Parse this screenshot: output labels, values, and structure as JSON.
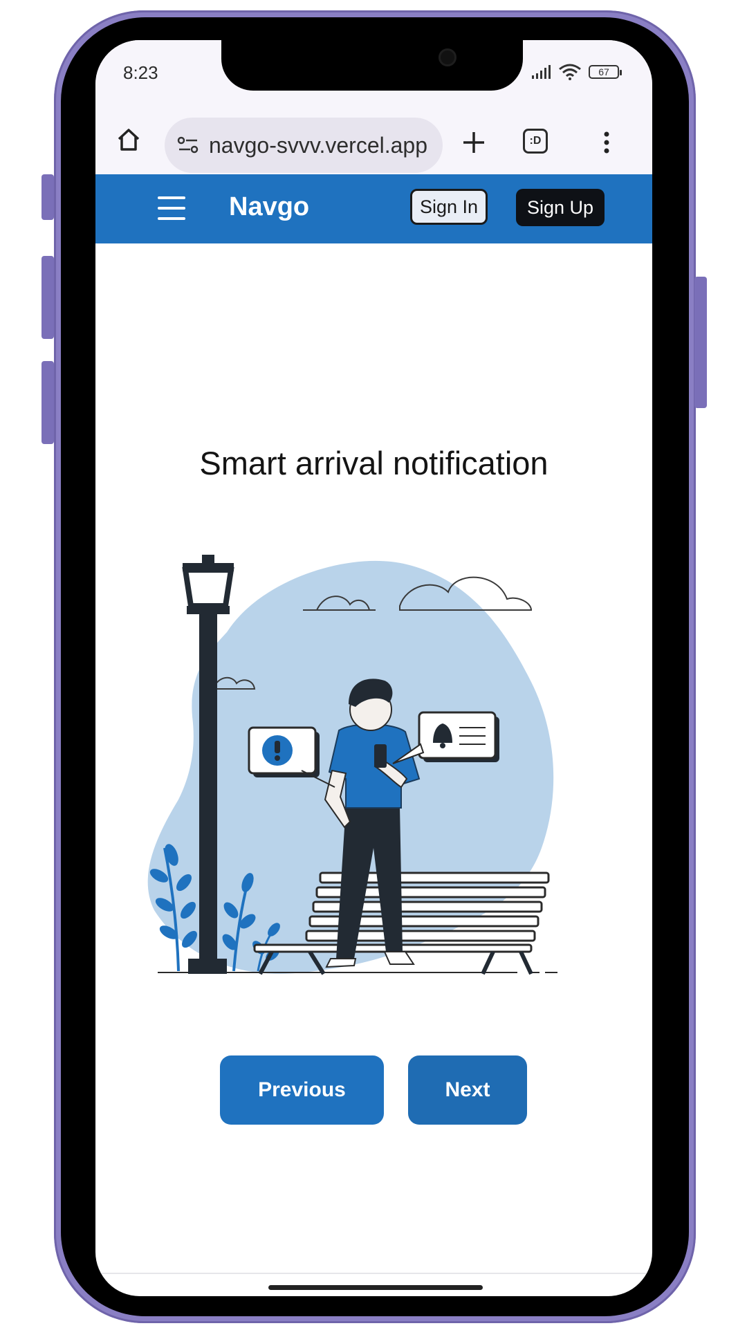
{
  "status_bar": {
    "time": "8:23",
    "battery": "67"
  },
  "browser": {
    "url": "navgo-svvv.vercel.app",
    "tab_label": ":D",
    "icons": [
      "home-icon",
      "site-settings-icon",
      "plus-icon",
      "tab-switcher-icon",
      "more-vert-icon"
    ]
  },
  "header": {
    "brand": "Navgo",
    "sign_in": "Sign In",
    "sign_up": "Sign Up",
    "color": "#1f72bf"
  },
  "main": {
    "title": "Smart arrival notification",
    "illustration": "person-with-phone-on-bench-illustration",
    "previous_label": "Previous",
    "next_label": "Next"
  },
  "colors": {
    "accent": "#1f72bf",
    "blob": "#b9d3ea",
    "dark": "#222a33"
  }
}
